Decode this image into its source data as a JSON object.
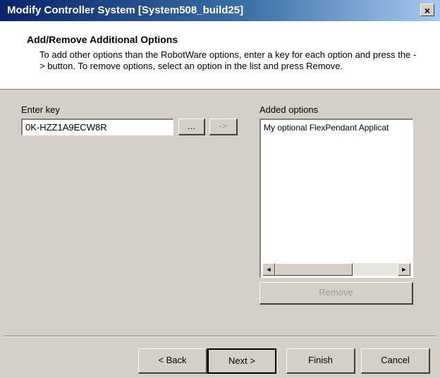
{
  "window": {
    "title": "Modify Controller System [System508_build25]",
    "close_label": "×"
  },
  "header": {
    "title": "Add/Remove Additional Options",
    "description": "To add other options than the RobotWare options, enter a key for each option and press the -> button. To remove options, select an option in the list and press Remove."
  },
  "key_entry": {
    "label": "Enter key",
    "value": "0K-HZZ1A9ECW8R",
    "browse_label": "...",
    "add_label": "->"
  },
  "options": {
    "label": "Added options",
    "items": [
      "My optional FlexPendant Applicat"
    ],
    "scroll_left": "◄",
    "scroll_right": "►",
    "remove_label": "Remove"
  },
  "footer": {
    "back_label": "< Back",
    "next_label": "Next >",
    "finish_label": "Finish",
    "cancel_label": "Cancel"
  },
  "colors": {
    "title_bar_start": "#0a246a",
    "title_bar_end": "#a6caf0",
    "dialog_bg": "#d4d0c8",
    "disabled_text": "#9a9a9a"
  }
}
